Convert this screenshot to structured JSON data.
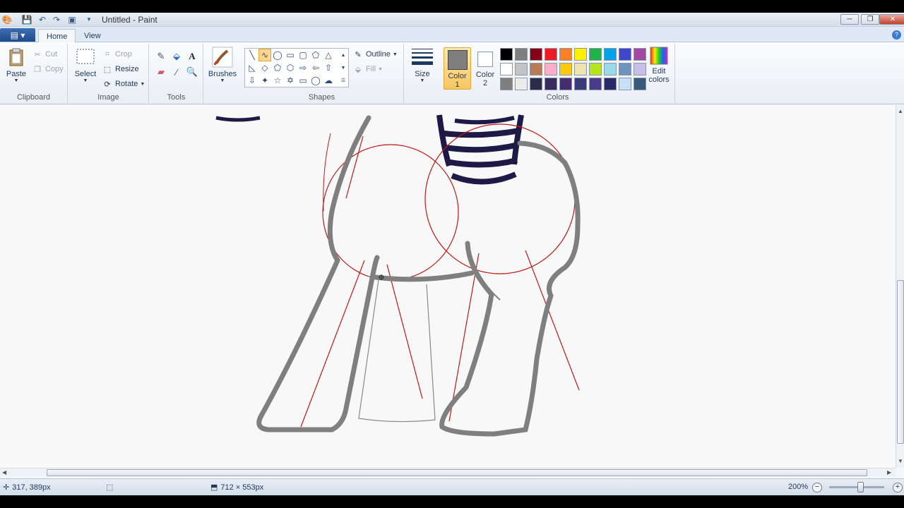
{
  "window": {
    "title": "Untitled - Paint"
  },
  "tabs": {
    "home": "Home",
    "view": "View"
  },
  "ribbon": {
    "clipboard": {
      "label": "Clipboard",
      "paste": "Paste",
      "cut": "Cut",
      "copy": "Copy"
    },
    "image": {
      "label": "Image",
      "select": "Select",
      "crop": "Crop",
      "resize": "Resize",
      "rotate": "Rotate"
    },
    "tools": {
      "label": "Tools"
    },
    "brushes": {
      "label": "Brushes"
    },
    "shapes": {
      "label": "Shapes",
      "outline": "Outline",
      "fill": "Fill"
    },
    "size": {
      "label": "Size"
    },
    "colors": {
      "label": "Colors",
      "color1_line1": "Color",
      "color1_line2": "1",
      "color2_line1": "Color",
      "color2_line2": "2",
      "edit_line1": "Edit",
      "edit_line2": "colors",
      "color1_value": "#7f7f7f",
      "color2_value": "#ffffff",
      "palette": [
        [
          "#000000",
          "#7f7f7f",
          "#880015",
          "#ed1c24",
          "#ff7f27",
          "#fff200",
          "#22b14c",
          "#00a2e8",
          "#3f48cc",
          "#a349a4"
        ],
        [
          "#ffffff",
          "#c3c3c3",
          "#b97a57",
          "#ffaec9",
          "#ffc90e",
          "#efe4b0",
          "#b5e61d",
          "#99d9ea",
          "#7092be",
          "#c8bfe7"
        ],
        [
          "#7f7f7f",
          "#ececec",
          "#2d2a4a",
          "#3b2a5e",
          "#442c6e",
          "#3a3a7a",
          "#4a3a8a",
          "#2a2a6a",
          "#c6e0f5",
          "#3a5a7a"
        ]
      ]
    }
  },
  "status": {
    "cursor_pos": "317, 389px",
    "image_size": "712 × 553px",
    "zoom": "200%"
  }
}
